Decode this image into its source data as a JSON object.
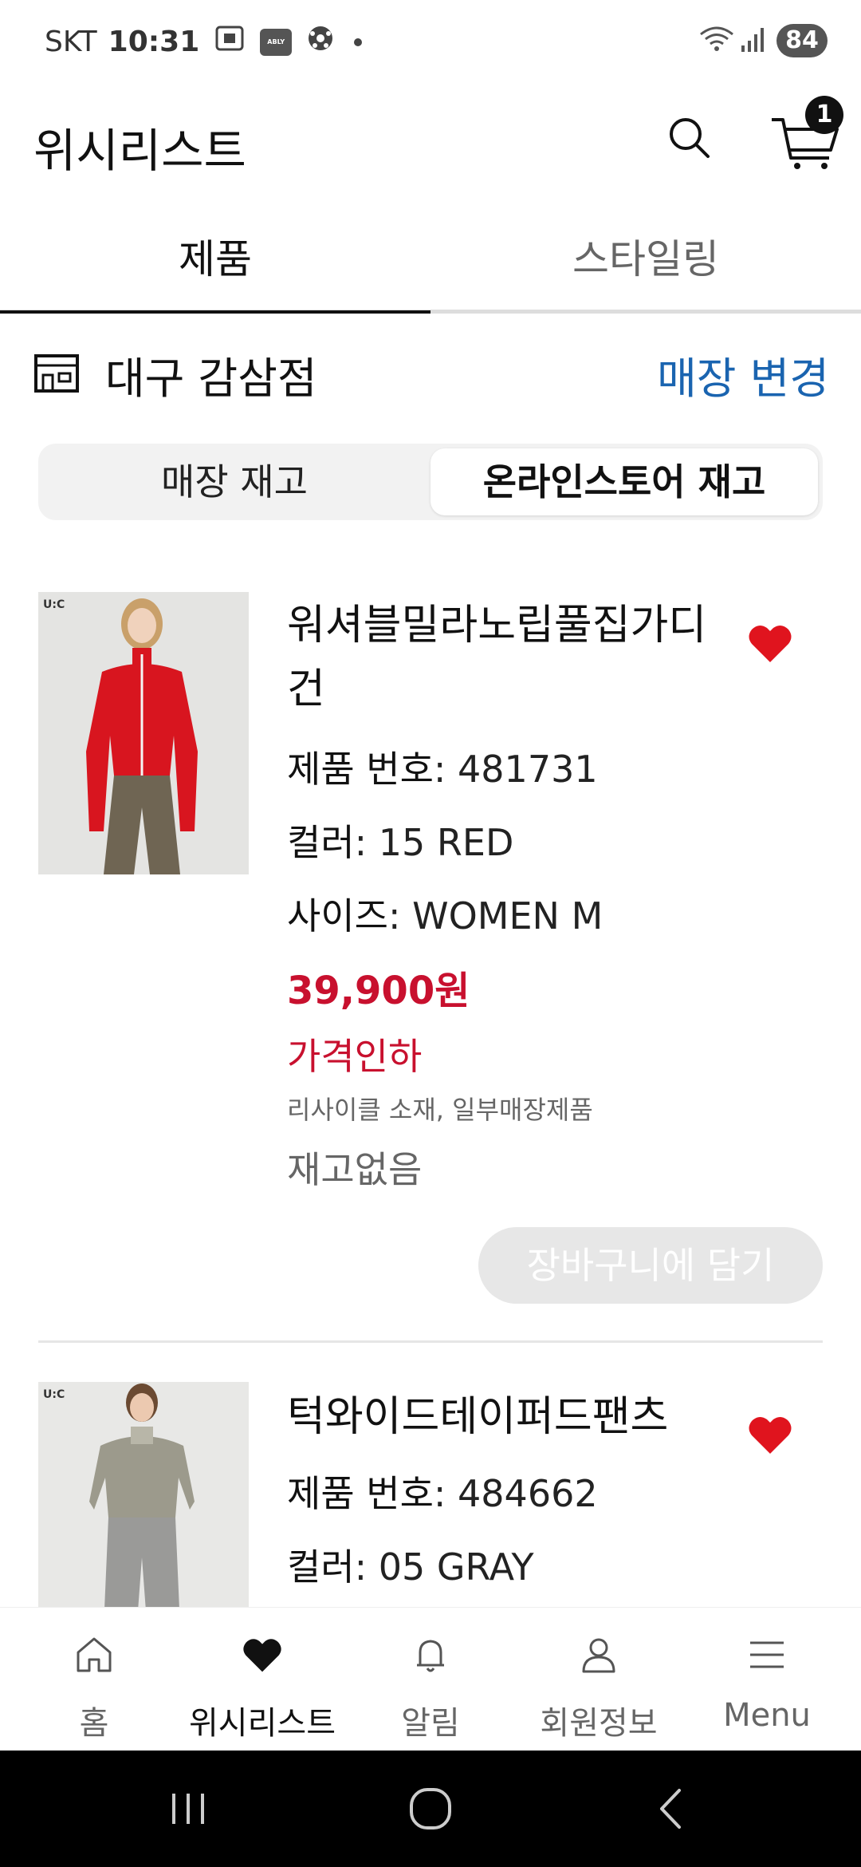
{
  "status_bar": {
    "carrier": "SKT",
    "time": "10:31",
    "app_badge": "ABLY",
    "battery": "84"
  },
  "header": {
    "title": "위시리스트",
    "cart_count": "1"
  },
  "tabs": [
    {
      "label": "제품",
      "active": true
    },
    {
      "label": "스타일링",
      "active": false
    }
  ],
  "store": {
    "name": "대구 감삼점",
    "change_label": "매장 변경"
  },
  "inventory_toggle": {
    "store_stock": "매장 재고",
    "online_stock": "온라인스토어 재고",
    "selected": "online_stock"
  },
  "products": [
    {
      "name": "워셔블밀라노립풀집가디건",
      "number_label": "제품 번호",
      "number": ": 481731",
      "color_label": "컬러",
      "color": ": 15 RED",
      "size_label": "사이즈",
      "size": ": WOMEN M",
      "price": "39,900원",
      "sale": "가격인하",
      "note": "리사이클 소재, 일부매장제품",
      "stock": "재고없음",
      "add_to_cart": "장바구니에 담기",
      "image_tag": "U:C"
    },
    {
      "name": "턱와이드테이퍼드팬츠",
      "number_label": "제품 번호",
      "number": ": 484662",
      "color_label": "컬러",
      "color": ": 05 GRAY",
      "image_tag": "U:C"
    }
  ],
  "bottom_nav": [
    {
      "label": "홈",
      "icon": "home-icon"
    },
    {
      "label": "위시리스트",
      "icon": "heart-icon",
      "active": true
    },
    {
      "label": "알림",
      "icon": "bell-icon"
    },
    {
      "label": "회원정보",
      "icon": "user-icon"
    },
    {
      "label": "Menu",
      "icon": "menu-icon"
    }
  ],
  "colors": {
    "accent_blue": "#1a64b0",
    "sale_red": "#c8102e",
    "heart_red": "#e0141e"
  }
}
